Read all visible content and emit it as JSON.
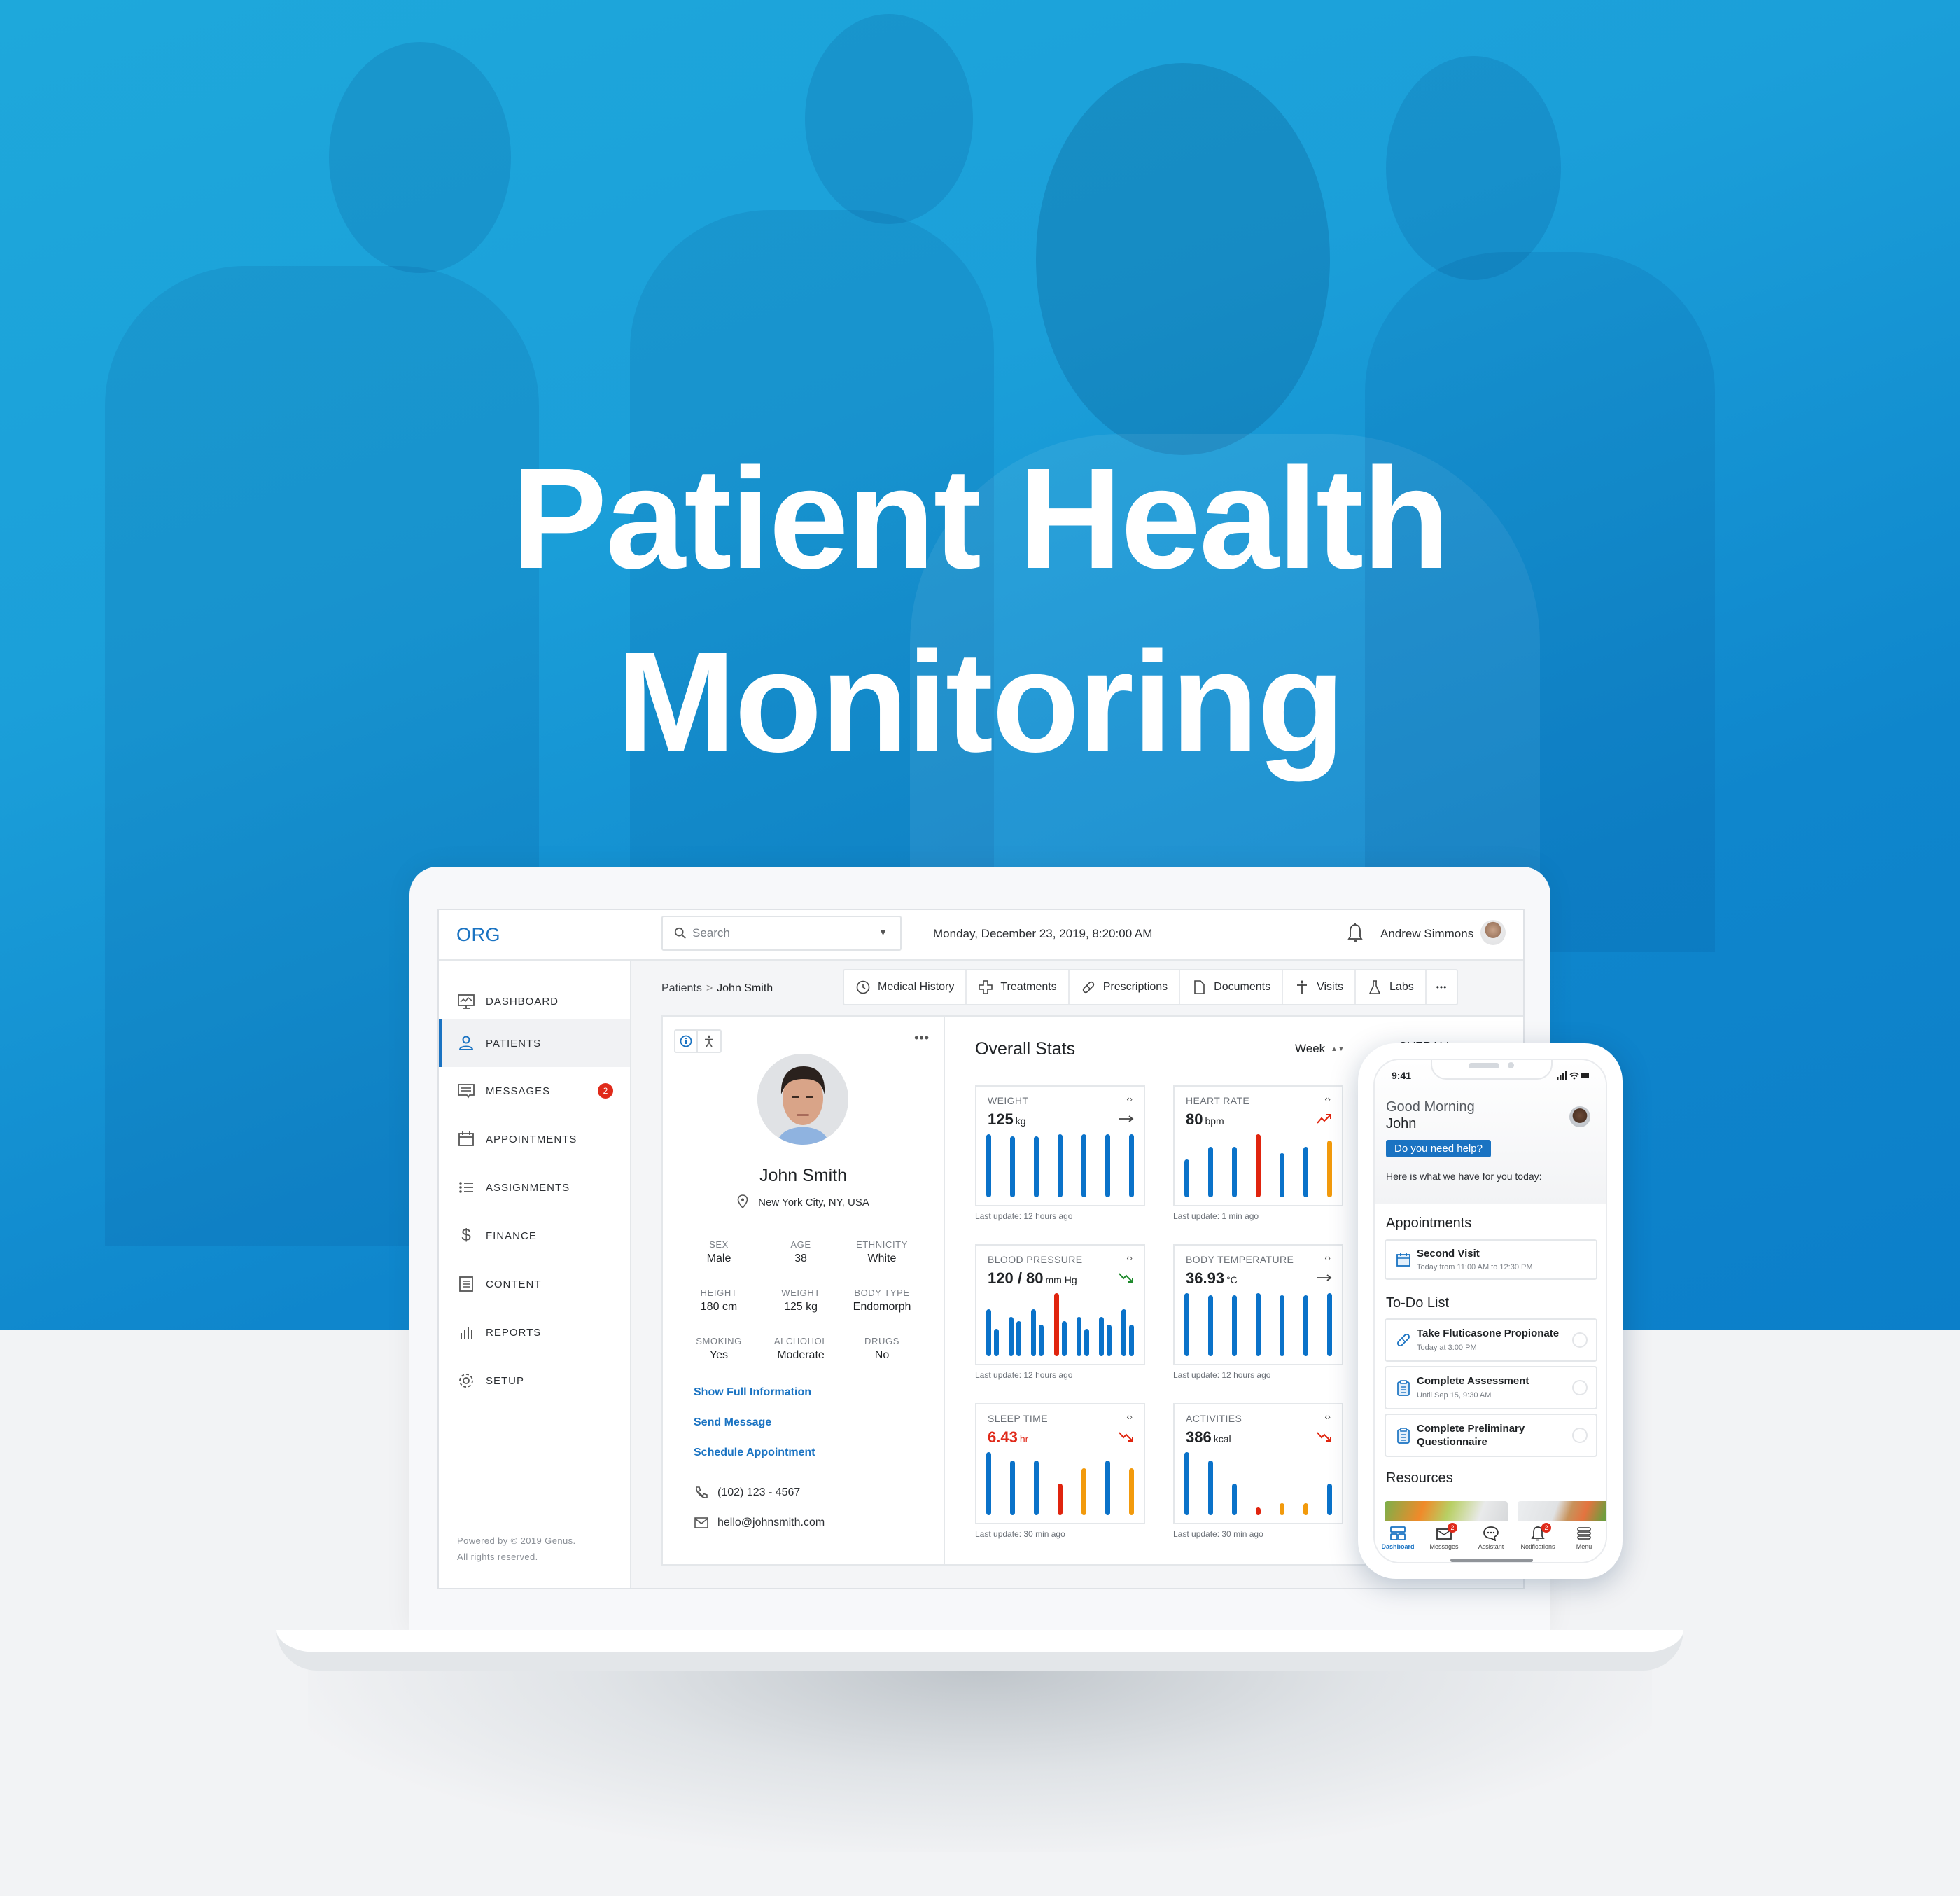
{
  "hero": {
    "title_line1": "Patient Health",
    "title_line2": "Monitoring"
  },
  "app": {
    "logo": "ORG",
    "search_placeholder": "Search",
    "datetime": "Monday, December 23, 2019, 8:20:00 AM",
    "user_name": "Andrew Simmons"
  },
  "sidebar": {
    "items": [
      {
        "label": "DASHBOARD",
        "icon": "dashboard-monitor-icon",
        "active": false
      },
      {
        "label": "PATIENTS",
        "icon": "user-icon",
        "active": true
      },
      {
        "label": "MESSAGES",
        "icon": "message-icon",
        "active": false,
        "badge": "2"
      },
      {
        "label": "APPOINTMENTS",
        "icon": "calendar-icon",
        "active": false
      },
      {
        "label": "ASSIGNMENTS",
        "icon": "list-icon",
        "active": false
      },
      {
        "label": "FINANCE",
        "icon": "dollar-icon",
        "active": false
      },
      {
        "label": "CONTENT",
        "icon": "document-icon",
        "active": false
      },
      {
        "label": "REPORTS",
        "icon": "bar-chart-icon",
        "active": false
      },
      {
        "label": "SETUP",
        "icon": "gear-icon",
        "active": false
      }
    ],
    "footer_line1": "Powered by © 2019 Genus.",
    "footer_line2": "All rights reserved."
  },
  "breadcrumb": {
    "parent": "Patients",
    "separator": ">",
    "current": "John Smith"
  },
  "tabs": [
    {
      "label": "Medical History",
      "icon": "history-icon"
    },
    {
      "label": "Treatments",
      "icon": "medical-cross-icon"
    },
    {
      "label": "Prescriptions",
      "icon": "pill-icon"
    },
    {
      "label": "Documents",
      "icon": "file-icon"
    },
    {
      "label": "Visits",
      "icon": "person-icon"
    },
    {
      "label": "Labs",
      "icon": "flask-icon"
    },
    {
      "label": "•••",
      "icon": "more-icon"
    }
  ],
  "patient": {
    "name": "John Smith",
    "location": "New York City, NY, USA",
    "attributes": [
      {
        "label": "SEX",
        "value": "Male"
      },
      {
        "label": "AGE",
        "value": "38"
      },
      {
        "label": "ETHNICITY",
        "value": "White"
      },
      {
        "label": "HEIGHT",
        "value": "180 cm"
      },
      {
        "label": "WEIGHT",
        "value": "125 kg"
      },
      {
        "label": "BODY TYPE",
        "value": "Endomorph"
      },
      {
        "label": "SMOKING",
        "value": "Yes"
      },
      {
        "label": "ALCHOHOL",
        "value": "Moderate"
      },
      {
        "label": "DRUGS",
        "value": "No"
      }
    ],
    "links": [
      "Show Full Information",
      "Send Message",
      "Schedule Appointment"
    ],
    "phone": "(102) 123 - 4567",
    "email": "hello@johnsmith.com",
    "more_label": "•••"
  },
  "stats": {
    "title": "Overall Stats",
    "period": "Week",
    "overall_label": "OVERALL",
    "expand_glyph": "‹›",
    "colors": {
      "normal": "#0a72c9",
      "high": "#e0240e",
      "warn": "#f29a0c",
      "down_good": "#1e8a2c"
    },
    "cards": [
      {
        "title": "WEIGHT",
        "value": "125",
        "unit": "kg",
        "trend": "flat",
        "value_color": "normal",
        "last_update": "Last update: 12 hours ago",
        "bars": [
          {
            "v": 1.0,
            "c": "normal"
          },
          {
            "v": 0.97,
            "c": "normal"
          },
          {
            "v": 0.97,
            "c": "normal"
          },
          {
            "v": 1.0,
            "c": "normal"
          },
          {
            "v": 1.0,
            "c": "normal"
          },
          {
            "v": 1.0,
            "c": "normal"
          },
          {
            "v": 1.0,
            "c": "normal"
          }
        ]
      },
      {
        "title": "HEART RATE",
        "value": "80",
        "unit": "bpm",
        "trend": "up-red",
        "value_color": "normal",
        "last_update": "Last update: 1 min ago",
        "bars": [
          {
            "v": 0.6,
            "c": "normal"
          },
          {
            "v": 0.8,
            "c": "normal"
          },
          {
            "v": 0.8,
            "c": "normal"
          },
          {
            "v": 1.0,
            "c": "high"
          },
          {
            "v": 0.7,
            "c": "normal"
          },
          {
            "v": 0.8,
            "c": "normal"
          },
          {
            "v": 0.9,
            "c": "warn"
          }
        ]
      },
      {
        "title": "BLOOD PRESSURE",
        "value": "120 / 80",
        "unit": "mm Hg",
        "trend": "down-green",
        "value_color": "normal",
        "last_update": "Last update: 12 hours ago",
        "bars": [
          {
            "v": 0.75,
            "c": "normal"
          },
          {
            "v": 0.43,
            "c": "normal"
          },
          {
            "v": 0.62,
            "c": "normal"
          },
          {
            "v": 0.56,
            "c": "normal"
          },
          {
            "v": 0.75,
            "c": "normal"
          },
          {
            "v": 0.5,
            "c": "normal"
          },
          {
            "v": 1.0,
            "c": "high"
          },
          {
            "v": 0.56,
            "c": "normal"
          },
          {
            "v": 0.62,
            "c": "normal"
          },
          {
            "v": 0.43,
            "c": "normal"
          },
          {
            "v": 0.62,
            "c": "normal"
          },
          {
            "v": 0.5,
            "c": "normal"
          },
          {
            "v": 0.75,
            "c": "normal"
          },
          {
            "v": 0.5,
            "c": "normal"
          }
        ]
      },
      {
        "title": "BODY TEMPERATURE",
        "value": "36.93",
        "unit": "°C",
        "trend": "flat",
        "value_color": "normal",
        "last_update": "Last update: 12 hours ago",
        "bars": [
          {
            "v": 1.0,
            "c": "normal"
          },
          {
            "v": 0.97,
            "c": "normal"
          },
          {
            "v": 0.97,
            "c": "normal"
          },
          {
            "v": 1.0,
            "c": "normal"
          },
          {
            "v": 0.97,
            "c": "normal"
          },
          {
            "v": 0.97,
            "c": "normal"
          },
          {
            "v": 1.0,
            "c": "normal"
          }
        ]
      },
      {
        "title": "SLEEP TIME",
        "value": "6.43",
        "unit": "hr",
        "trend": "down-red",
        "value_color": "high",
        "last_update": "Last update: 30 min ago",
        "bars": [
          {
            "v": 1.0,
            "c": "normal"
          },
          {
            "v": 0.87,
            "c": "normal"
          },
          {
            "v": 0.87,
            "c": "normal"
          },
          {
            "v": 0.5,
            "c": "high"
          },
          {
            "v": 0.75,
            "c": "warn"
          },
          {
            "v": 0.87,
            "c": "normal"
          },
          {
            "v": 0.75,
            "c": "warn"
          }
        ]
      },
      {
        "title": "ACTIVITIES",
        "value": "386",
        "unit": "kcal",
        "trend": "down-red",
        "value_color": "normal",
        "last_update": "Last update: 30 min ago",
        "bars": [
          {
            "v": 1.0,
            "c": "normal"
          },
          {
            "v": 0.87,
            "c": "normal"
          },
          {
            "v": 0.5,
            "c": "normal"
          },
          {
            "v": 0.12,
            "c": "high"
          },
          {
            "v": 0.19,
            "c": "warn"
          },
          {
            "v": 0.19,
            "c": "warn"
          },
          {
            "v": 0.5,
            "c": "normal"
          }
        ]
      }
    ]
  },
  "phone": {
    "time": "9:41",
    "greeting": "Good Morning",
    "name": "John",
    "help_button": "Do you need help?",
    "subtitle": "Here is what we have for you today:",
    "appointments_title": "Appointments",
    "appointment": {
      "title": "Second Visit",
      "subtitle": "Today from 11:00 AM to 12:30 PM"
    },
    "todo_title": "To-Do List",
    "todos": [
      {
        "title": "Take Fluticasone Propionate",
        "subtitle": "Today at 3:00 PM",
        "icon": "pill-icon"
      },
      {
        "title": "Complete Assessment",
        "subtitle": "Until Sep 15, 9:30 AM",
        "icon": "clipboard-icon"
      },
      {
        "title": "Complete Preliminary Questionnaire",
        "subtitle": "",
        "icon": "clipboard-icon"
      }
    ],
    "resources_title": "Resources",
    "tabbar": [
      {
        "label": "Dashboard",
        "active": true
      },
      {
        "label": "Messages",
        "badge": "2"
      },
      {
        "label": "Assistant"
      },
      {
        "label": "Notifications",
        "badge": "2"
      },
      {
        "label": "Menu"
      }
    ]
  }
}
